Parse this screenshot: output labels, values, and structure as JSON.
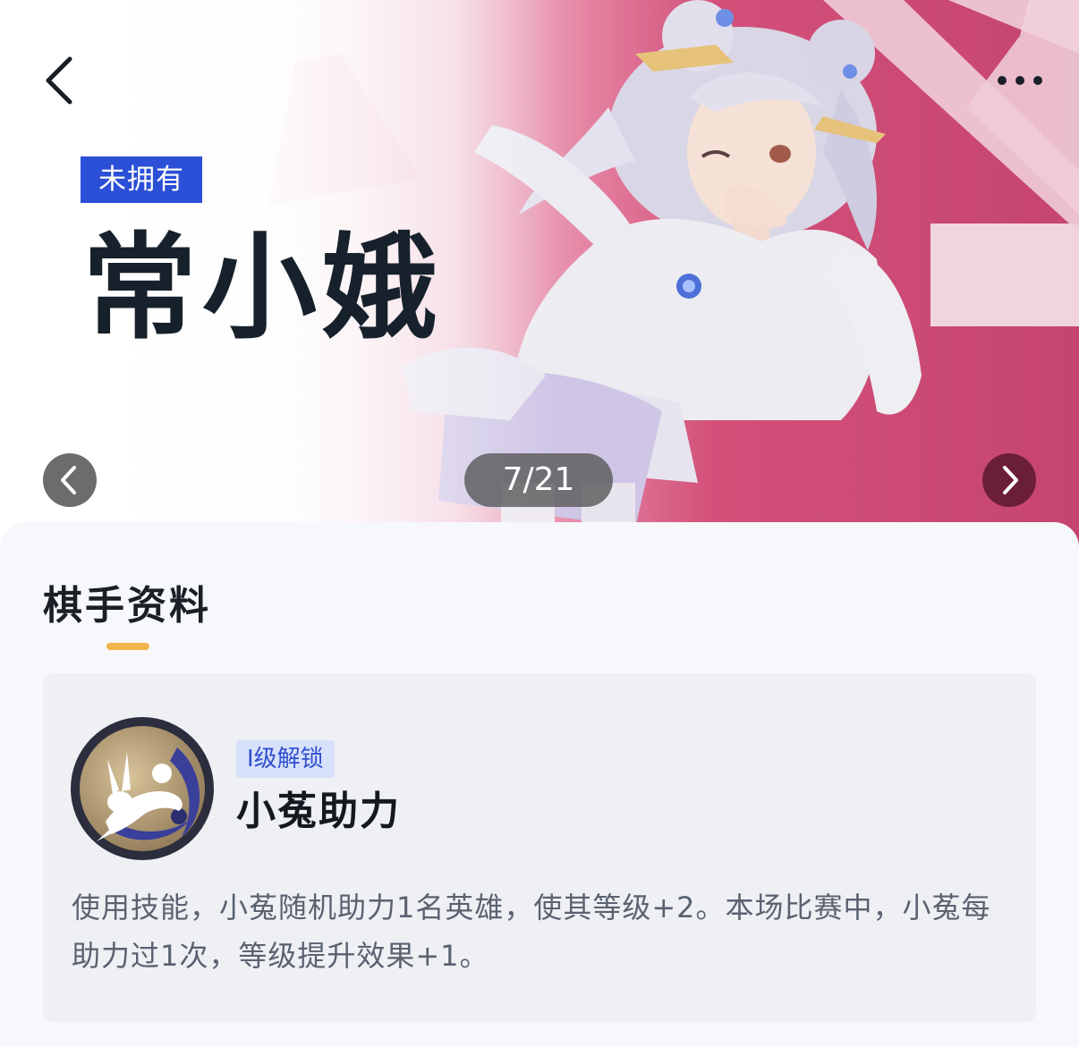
{
  "hero": {
    "owned_status": "未拥有",
    "character_name": "常小娥",
    "page_indicator": "7/21"
  },
  "icons": {
    "back": "chevron-left-icon",
    "more": "more-horizontal-icon",
    "prev": "chevron-left-icon",
    "next": "chevron-right-icon",
    "skill": "rabbit-icon"
  },
  "section": {
    "title": "棋手资料"
  },
  "skill": {
    "unlock_label": "I级解锁",
    "name": "小菟助力",
    "description": "使用技能，小菟随机助力1名英雄，使其等级+2。本场比赛中，小菟每助力过1次，等级提升效果+1。"
  },
  "colors": {
    "badge_blue": "#2b4fd6",
    "hero_pink": "#c6456f",
    "next_button": "#6b1f36",
    "underline_gold": "#f0b64c",
    "tag_bg": "#d8e1fb",
    "tag_text": "#2f4fcf"
  }
}
